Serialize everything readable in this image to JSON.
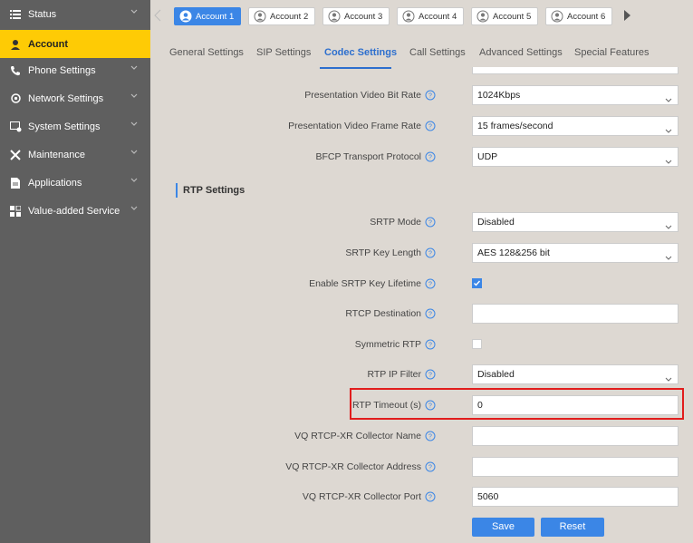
{
  "sidebar": {
    "items": [
      {
        "label": "Status",
        "icon": "list-icon",
        "expandable": true,
        "active": false
      },
      {
        "label": "Account",
        "icon": "user-icon",
        "expandable": false,
        "active": true
      },
      {
        "label": "Phone Settings",
        "icon": "phone-icon",
        "expandable": true,
        "active": false
      },
      {
        "label": "Network Settings",
        "icon": "network-gear-icon",
        "expandable": true,
        "active": false
      },
      {
        "label": "System Settings",
        "icon": "system-settings-icon",
        "expandable": true,
        "active": false
      },
      {
        "label": "Maintenance",
        "icon": "tools-icon",
        "expandable": true,
        "active": false
      },
      {
        "label": "Applications",
        "icon": "document-icon",
        "expandable": true,
        "active": false
      },
      {
        "label": "Value-added Service",
        "icon": "grid-icon",
        "expandable": true,
        "active": false
      }
    ]
  },
  "accounts": {
    "items": [
      {
        "label": "Account 1",
        "active": true
      },
      {
        "label": "Account 2",
        "active": false
      },
      {
        "label": "Account 3",
        "active": false
      },
      {
        "label": "Account 4",
        "active": false
      },
      {
        "label": "Account 5",
        "active": false
      },
      {
        "label": "Account 6",
        "active": false
      }
    ]
  },
  "tabs": [
    {
      "label": "General Settings",
      "active": false
    },
    {
      "label": "SIP Settings",
      "active": false
    },
    {
      "label": "Codec Settings",
      "active": true
    },
    {
      "label": "Call Settings",
      "active": false
    },
    {
      "label": "Advanced Settings",
      "active": false
    },
    {
      "label": "Special Features",
      "active": false
    }
  ],
  "fields": {
    "presentation_bitrate": {
      "label": "Presentation Video Bit Rate",
      "value": "1024Kbps"
    },
    "presentation_framerate": {
      "label": "Presentation Video Frame Rate",
      "value": "15 frames/second"
    },
    "bfcp_protocol": {
      "label": "BFCP Transport Protocol",
      "value": "UDP"
    },
    "rtp_section": "RTP Settings",
    "srtp_mode": {
      "label": "SRTP Mode",
      "value": "Disabled"
    },
    "srtp_key_length": {
      "label": "SRTP Key Length",
      "value": "AES 128&256 bit"
    },
    "srtp_key_lifetime": {
      "label": "Enable SRTP Key Lifetime",
      "checked": true
    },
    "rtcp_destination": {
      "label": "RTCP Destination",
      "value": ""
    },
    "symmetric_rtp": {
      "label": "Symmetric RTP",
      "checked": false
    },
    "rtp_ip_filter": {
      "label": "RTP IP Filter",
      "value": "Disabled"
    },
    "rtp_timeout": {
      "label": "RTP Timeout (s)",
      "value": "0"
    },
    "vq_collector_name": {
      "label": "VQ RTCP-XR Collector Name",
      "value": ""
    },
    "vq_collector_address": {
      "label": "VQ RTCP-XR Collector Address",
      "value": ""
    },
    "vq_collector_port": {
      "label": "VQ RTCP-XR Collector Port",
      "value": "5060"
    }
  },
  "buttons": {
    "save": "Save",
    "reset": "Reset"
  },
  "colors": {
    "accent": "#3b86e6",
    "sidebar_bg": "#5f5f5f",
    "active_nav": "#fecb05",
    "highlight": "#e11d1d"
  }
}
